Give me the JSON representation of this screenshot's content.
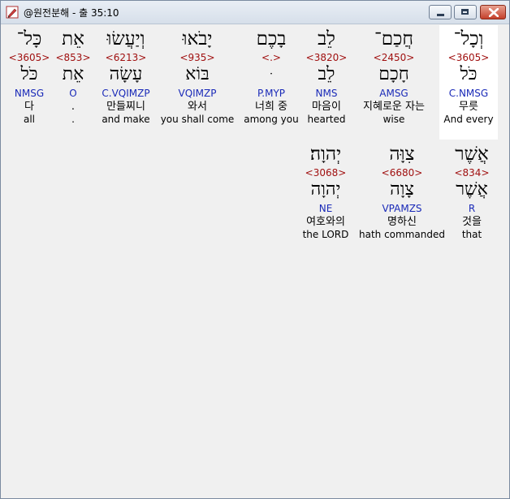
{
  "window": {
    "title": "@원전분해 - 출 35:10",
    "icon": "app-pencil-icon"
  },
  "rows": [
    {
      "words": [
        {
          "hebrew": "כָּל־",
          "strong": "<3605>",
          "lemma": "כֹּל",
          "parse": "NMSG",
          "korean": "다",
          "english": "all"
        },
        {
          "hebrew": "אֵת",
          "strong": "<853>",
          "lemma": "אֵת",
          "parse": "O",
          "korean": ".",
          "english": "."
        },
        {
          "hebrew": "וְיַעֲשׂוּ",
          "strong": "<6213>",
          "lemma": "עָשָׂה",
          "parse": "C.VQIMZP",
          "korean": "만들찌니",
          "english": "and make"
        },
        {
          "hebrew": "יָבֹאוּ",
          "strong": "<935>",
          "lemma": "בּוֹא",
          "parse": "VQIMZP",
          "korean": "와서",
          "english": "you shall come"
        },
        {
          "hebrew": "בָכֶם",
          "strong": "<.>",
          "lemma": "ּ",
          "parse": "P.MYP",
          "korean": "너희 중",
          "english": "among you"
        },
        {
          "hebrew": "לֵב",
          "strong": "<3820>",
          "lemma": "לֵב",
          "parse": "NMS",
          "korean": "마음이",
          "english": "hearted"
        },
        {
          "hebrew": "חֲכַם־",
          "strong": "<2450>",
          "lemma": "חָכָם",
          "parse": "AMSG",
          "korean": "지혜로운 자는",
          "english": "wise"
        },
        {
          "hebrew": "וְכָל־",
          "strong": "<3605>",
          "lemma": "כֹּל",
          "parse": "C.NMSG",
          "korean": "무릇",
          "english": "And every",
          "selected": true
        }
      ]
    },
    {
      "words": [
        {
          "hebrew": "יְהוָה׃",
          "strong": "<3068>",
          "lemma": "יְהוָה",
          "parse": "NE",
          "korean": "여호와의",
          "english": "the LORD"
        },
        {
          "hebrew": "צִוָּה",
          "strong": "<6680>",
          "lemma": "צָוָה",
          "parse": "VPAMZS",
          "korean": "명하신",
          "english": "hath commanded"
        },
        {
          "hebrew": "אֲשֶׁר",
          "strong": "<834>",
          "lemma": "אֲשֶׁר",
          "parse": "R",
          "korean": "것을",
          "english": "that"
        }
      ]
    }
  ]
}
